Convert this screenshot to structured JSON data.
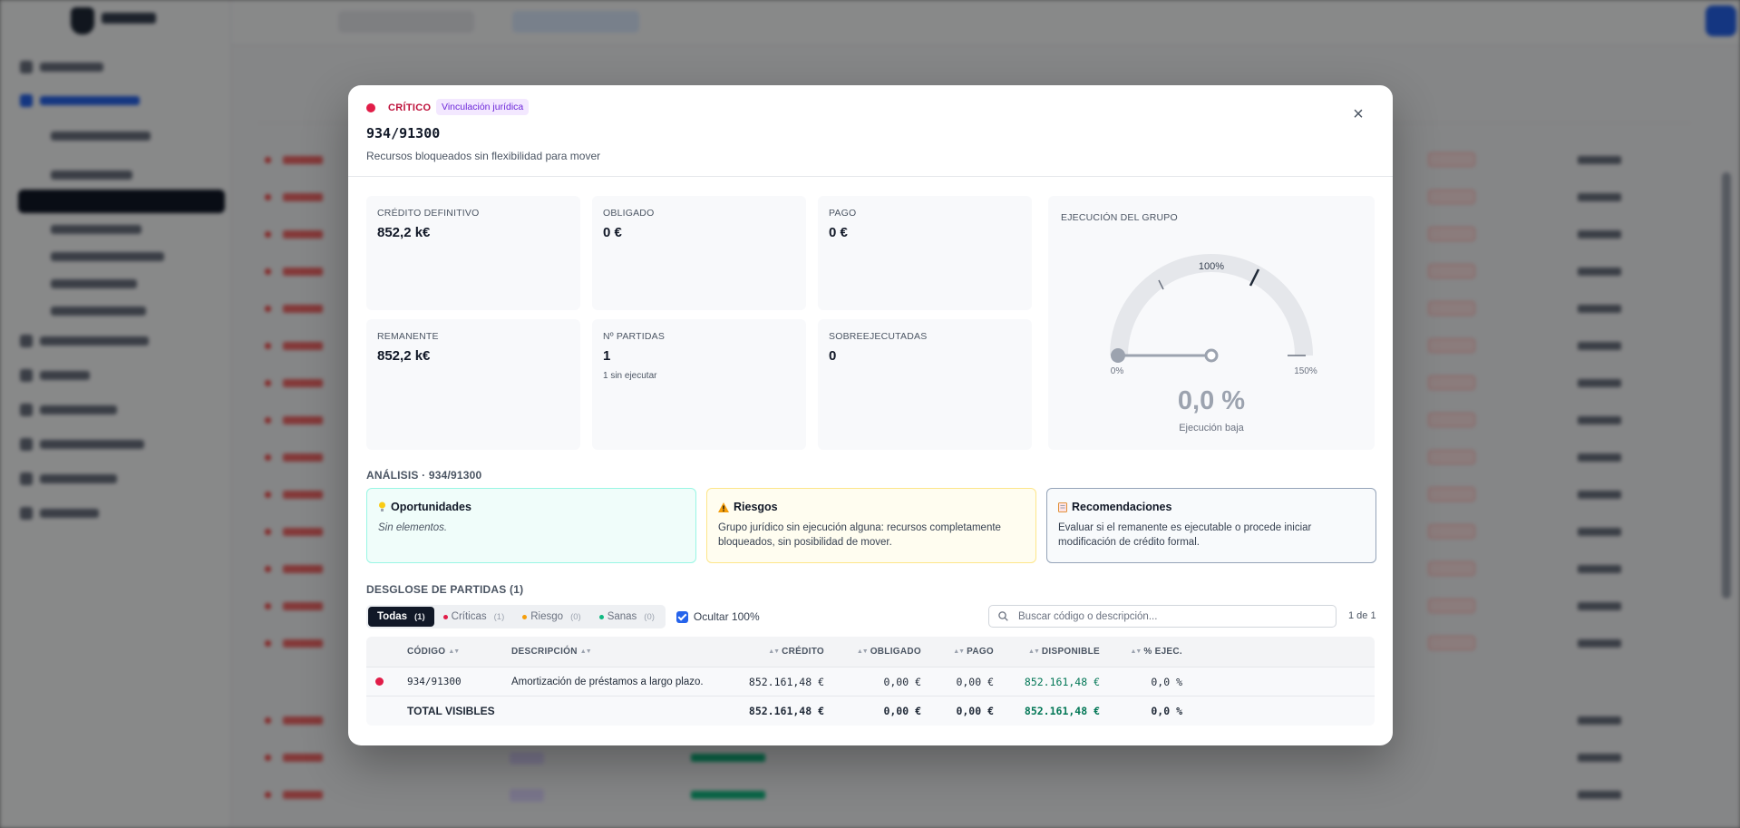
{
  "modal": {
    "severity_label": "CRÍTICO",
    "tag": "Vinculación jurídica",
    "title": "934/91300",
    "subtitle": "Recursos bloqueados sin flexibilidad para mover",
    "close_label": "×",
    "stats": [
      {
        "label": "CRÉDITO DEFINITIVO",
        "value": "852,2 k€",
        "note": ""
      },
      {
        "label": "OBLIGADO",
        "value": "0 €",
        "note": ""
      },
      {
        "label": "PAGO",
        "value": "0 €",
        "note": ""
      },
      {
        "label": "REMANENTE",
        "value": "852,2 k€",
        "note": ""
      },
      {
        "label": "Nº PARTIDAS",
        "value": "1",
        "note": "1 sin ejecutar"
      },
      {
        "label": "SOBREEJECUTADAS",
        "value": "0",
        "note": ""
      }
    ],
    "gauge": {
      "label": "EJECUCIÓN DEL GRUPO",
      "tick_100": "100%",
      "tick_0": "0%",
      "tick_150": "150%",
      "value_text": "0,0 %",
      "value_fraction": 0.0,
      "caption": "Ejecución baja",
      "colors": {
        "track": "#e5e7eb",
        "needle": "#9ca3af",
        "tick": "#1f2937"
      }
    },
    "analysis": {
      "title": "ANÁLISIS · 934/91300",
      "opportunities": {
        "title": "Oportunidades",
        "text": "Sin elementos."
      },
      "risks": {
        "title": "Riesgos",
        "text": "Grupo jurídico sin ejecución alguna: recursos completamente bloqueados, sin posibilidad de mover."
      },
      "recommendations": {
        "title": "Recomendaciones",
        "text": "Evaluar si el remanente es ejecutable o procede iniciar modificación de crédito formal."
      }
    },
    "breakdown": {
      "title": "DESGLOSE DE PARTIDAS (1)",
      "filters": [
        {
          "label": "Todas",
          "count": "(1)",
          "active": true,
          "dot": ""
        },
        {
          "label": "Críticas",
          "count": "(1)",
          "active": false,
          "dot": "#e11d48"
        },
        {
          "label": "Riesgo",
          "count": "(0)",
          "active": false,
          "dot": "#f59e0b"
        },
        {
          "label": "Sanas",
          "count": "(0)",
          "active": false,
          "dot": "#10b981"
        }
      ],
      "hide_full_label": "Ocultar 100%",
      "hide_full_checked": true,
      "search_placeholder": "Buscar código o descripción...",
      "pager": "1 de 1",
      "columns": {
        "code": "CÓDIGO",
        "description": "DESCRIPCIÓN",
        "credit": "CRÉDITO",
        "obligated": "OBLIGADO",
        "paid": "PAGO",
        "available": "DISPONIBLE",
        "exec": "% EJEC."
      },
      "rows": [
        {
          "code": "934/91300",
          "description": "Amortización de préstamos a largo plazo.",
          "credit": "852.161,48 €",
          "obligated": "0,00 €",
          "paid": "0,00 €",
          "available": "852.161,48 €",
          "exec": "0,0 %"
        }
      ],
      "total": {
        "label": "TOTAL VISIBLES",
        "credit": "852.161,48 €",
        "obligated": "0,00 €",
        "paid": "0,00 €",
        "available": "852.161,48 €",
        "exec": "0,0 %"
      }
    }
  },
  "colors": {
    "critical": "#e11d48",
    "available_green": "#047857",
    "active_filter": "#111827"
  }
}
